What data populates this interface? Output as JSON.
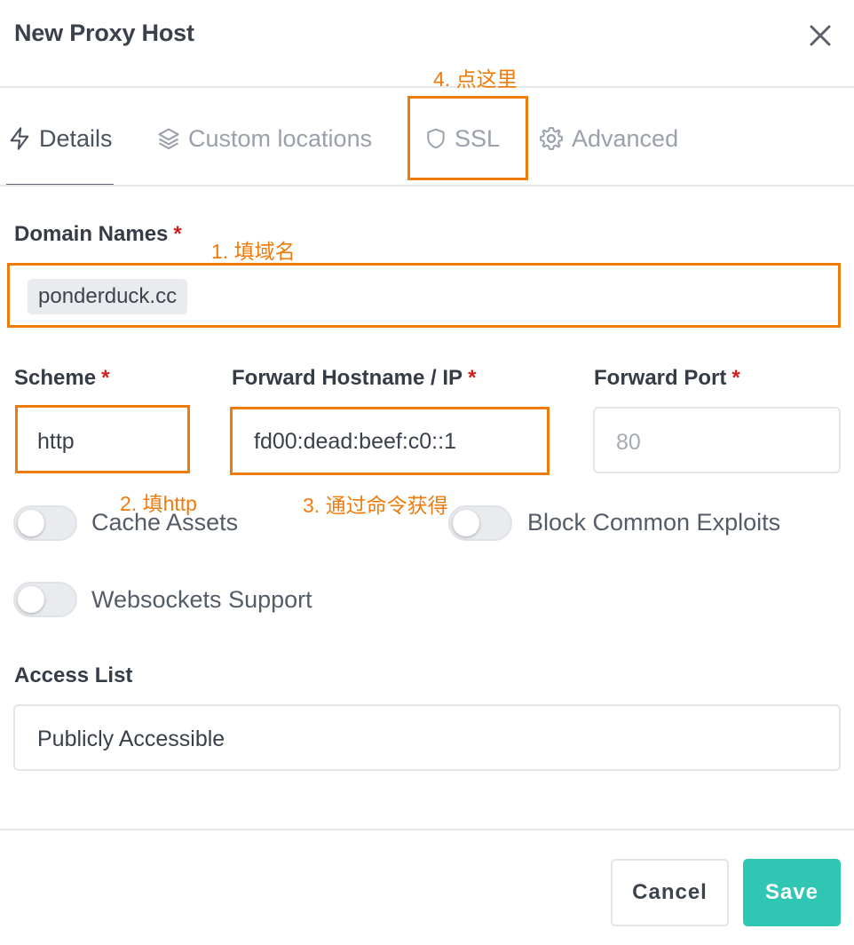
{
  "modal": {
    "title": "New Proxy Host"
  },
  "tabs": [
    {
      "label": "Details",
      "icon": "lightning-icon",
      "active": true
    },
    {
      "label": "Custom locations",
      "icon": "layers-icon",
      "active": false
    },
    {
      "label": "SSL",
      "icon": "shield-icon",
      "active": false
    },
    {
      "label": "Advanced",
      "icon": "gear-icon",
      "active": false
    }
  ],
  "form": {
    "domain_names": {
      "label": "Domain Names",
      "required": "*",
      "values": [
        "ponderduck.cc"
      ]
    },
    "scheme": {
      "label": "Scheme",
      "required": "*",
      "value": "http"
    },
    "forward_host": {
      "label": "Forward Hostname / IP",
      "required": "*",
      "value": "fd00:dead:beef:c0::1"
    },
    "forward_port": {
      "label": "Forward Port",
      "required": "*",
      "value": "",
      "placeholder": "80"
    },
    "toggles": [
      {
        "label": "Cache Assets",
        "on": false
      },
      {
        "label": "Block Common Exploits",
        "on": false
      },
      {
        "label": "Websockets Support",
        "on": false
      }
    ],
    "access_list": {
      "label": "Access List",
      "value": "Publicly Accessible"
    }
  },
  "annotations": {
    "step1": "1. 填域名",
    "step2": "2. 填http",
    "step3": "3. 通过命令获得",
    "step4": "4. 点这里"
  },
  "buttons": {
    "cancel": "Cancel",
    "save": "Save"
  },
  "colors": {
    "accent": "#2fc7b3",
    "annotation": "#f07b0d",
    "required": "#cd201f"
  }
}
